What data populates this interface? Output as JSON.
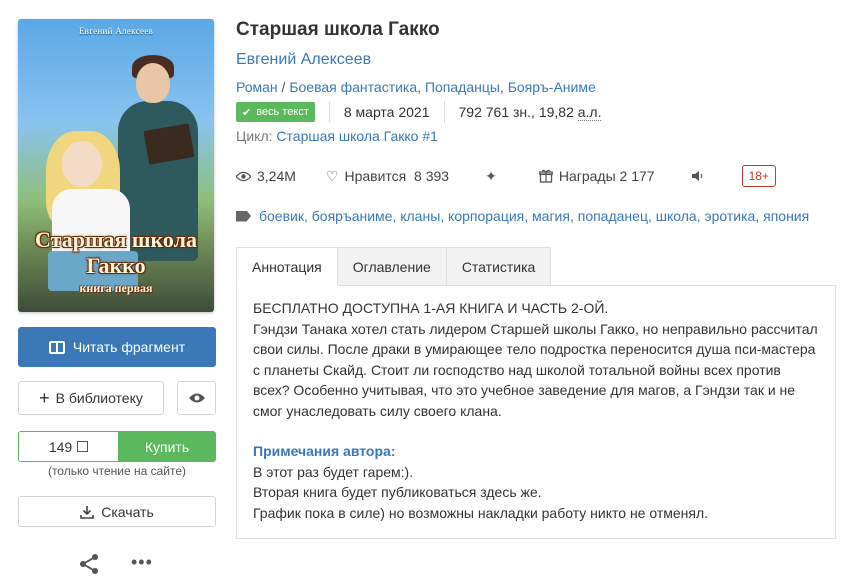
{
  "cover": {
    "author": "Евгений Алексеев",
    "title_line1": "Старшая школа",
    "title_line2": "Гакко",
    "subtitle": "книга первая"
  },
  "left": {
    "read_label": "Читать фрагмент",
    "library_label": "В библиотеку",
    "price": "149",
    "buy_label": "Купить",
    "read_only_note": "(только чтение на сайте)",
    "download_label": "Скачать"
  },
  "book": {
    "title": "Старшая школа Гакко",
    "author": "Евгений Алексеев",
    "genres": [
      "Роман",
      "Боевая фантастика",
      "Попаданцы",
      "Бояръ-Аниме"
    ],
    "genre_sep": " / ",
    "full_text_badge": "весь текст",
    "date": "8 марта 2021",
    "size_chars": "792 761 зн., 19,82",
    "size_unit": "а.л.",
    "cycle_label": "Цикл:",
    "cycle_name": "Старшая школа Гакко #1"
  },
  "stats": {
    "views": "3,24M",
    "likes_label": "Нравится",
    "likes": "8 393",
    "awards_label": "Награды",
    "awards": "2 177",
    "age": "18+"
  },
  "tags": [
    "боевик",
    "бояръаниме",
    "кланы",
    "корпорация",
    "магия",
    "попаданец",
    "школа",
    "эротика",
    "япония"
  ],
  "tabs": [
    "Аннотация",
    "Оглавление",
    "Статистика"
  ],
  "annotation": {
    "line1": "БЕСПЛАТНО ДОСТУПНА 1-АЯ КНИГА И ЧАСТЬ 2-ОЙ.",
    "body": "Гэндзи Танака хотел стать лидером Старшей школы Гакко, но неправильно рассчитал свои силы. После драки в умирающее тело подростка переносится душа пси-мастера с планеты Скайд. Стоит ли господство над школой тотальной войны всех против всех? Особенно учитывая, что это учебное заведение для магов, а Гэндзи так и не смог унаследовать силу своего клана.",
    "notes_heading": "Примечания автора:",
    "note1": "В этот раз будет гарем:).",
    "note2": "Вторая книга будет публиковаться здесь же.",
    "note3": "График пока в силе) но возможны накладки работу никто не отменял."
  },
  "colors": {
    "accent": "#3a78b8",
    "green": "#5cb85c",
    "age_red": "#c0392b"
  },
  "icons": [
    "book-open-icon",
    "plus-icon",
    "eye-icon",
    "currency-icon",
    "download-icon",
    "share-icon",
    "more-icon",
    "check-icon",
    "views-eye-icon",
    "heart-icon",
    "sparkles-icon",
    "gift-icon",
    "speaker-icon",
    "tag-icon"
  ]
}
